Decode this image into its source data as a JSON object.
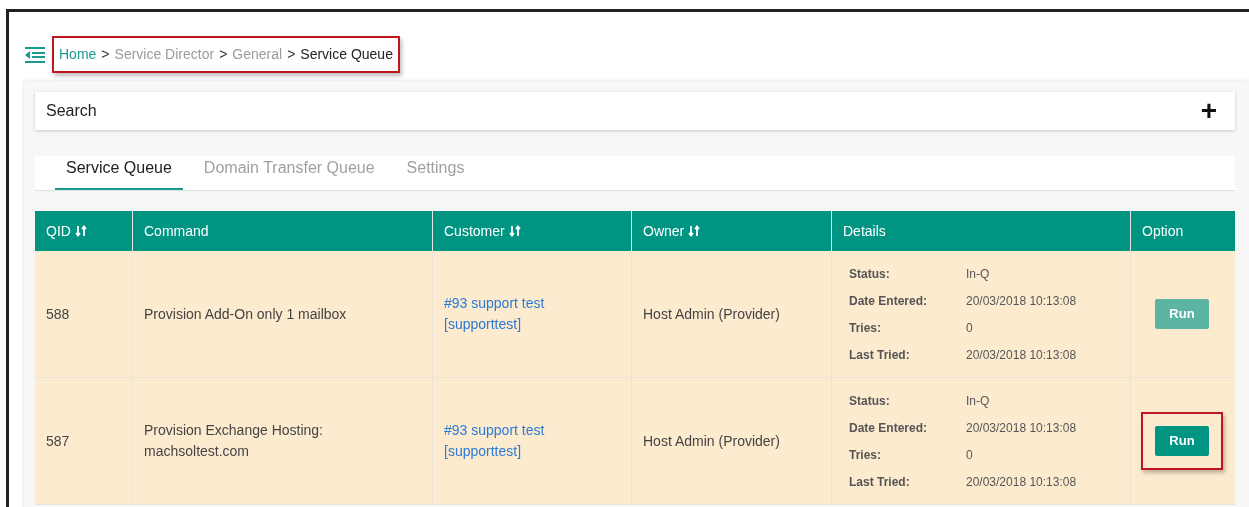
{
  "breadcrumb": {
    "annotated": true,
    "items": [
      {
        "label": "Home",
        "kind": "link"
      },
      {
        "label": ">",
        "kind": "sep"
      },
      {
        "label": "Service Director",
        "kind": "muted"
      },
      {
        "label": ">",
        "kind": "sep"
      },
      {
        "label": "General",
        "kind": "muted"
      },
      {
        "label": ">",
        "kind": "sep"
      },
      {
        "label": "Service Queue",
        "kind": "current"
      }
    ]
  },
  "search": {
    "label": "Search",
    "add_button": "+"
  },
  "tabs": [
    {
      "label": "Service Queue",
      "selected": true
    },
    {
      "label": "Domain Transfer Queue",
      "selected": false
    },
    {
      "label": "Settings",
      "selected": false
    }
  ],
  "table": {
    "columns": [
      {
        "label": "QID",
        "sortable": true
      },
      {
        "label": "Command",
        "sortable": false
      },
      {
        "label": "Customer",
        "sortable": true
      },
      {
        "label": "Owner",
        "sortable": true
      },
      {
        "label": "Details",
        "sortable": false
      },
      {
        "label": "Option",
        "sortable": false
      }
    ],
    "rows": [
      {
        "qid": "588",
        "command": "Provision Add-On only 1 mailbox",
        "customer": [
          "#93 support test",
          "[supporttest]"
        ],
        "owner": "Host Admin (Provider)",
        "details": [
          [
            "Status:",
            "In-Q"
          ],
          [
            "Date Entered:",
            "20/03/2018 10:13:08"
          ],
          [
            "Tries:",
            "0"
          ],
          [
            "Last Tried:",
            "20/03/2018 10:13:08"
          ]
        ],
        "button": {
          "label": "Run",
          "dimmed": true,
          "annotated": false
        }
      },
      {
        "qid": "587",
        "command": "Provision Exchange Hosting: machsoltest.com",
        "customer": [
          "#93 support test",
          "[supporttest]"
        ],
        "owner": "Host Admin (Provider)",
        "details": [
          [
            "Status:",
            "In-Q"
          ],
          [
            "Date Entered:",
            "20/03/2018 10:13:08"
          ],
          [
            "Tries:",
            "0"
          ],
          [
            "Last Tried:",
            "20/03/2018 10:13:08"
          ]
        ],
        "button": {
          "label": "Run",
          "dimmed": false,
          "annotated": true
        }
      }
    ]
  }
}
